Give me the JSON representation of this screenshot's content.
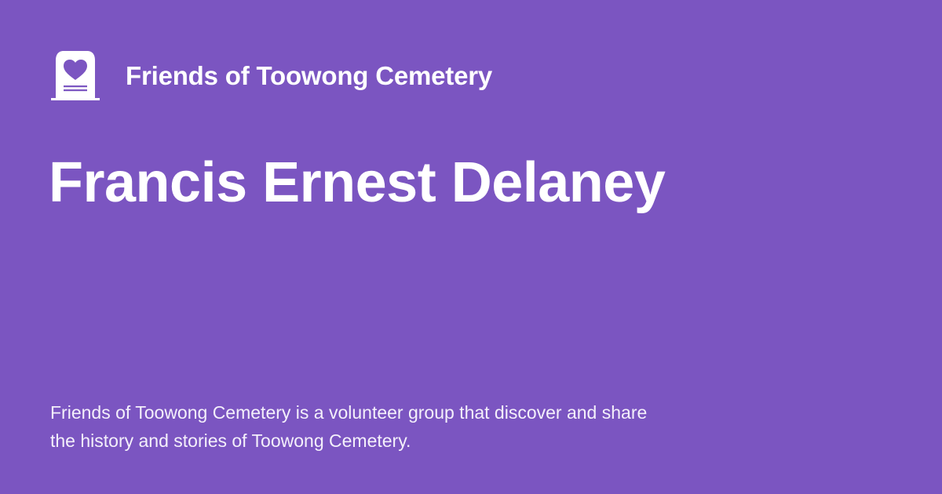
{
  "brand": {
    "name": "Friends of Toowong Cemetery",
    "logo_icon": "headstone-heart-icon"
  },
  "page": {
    "title": "Francis Ernest Delaney",
    "description": "Friends of Toowong Cemetery is a volunteer group that discover and share the history and stories of Toowong Cemetery."
  },
  "colors": {
    "background": "#7b55c1",
    "foreground": "#ffffff"
  }
}
